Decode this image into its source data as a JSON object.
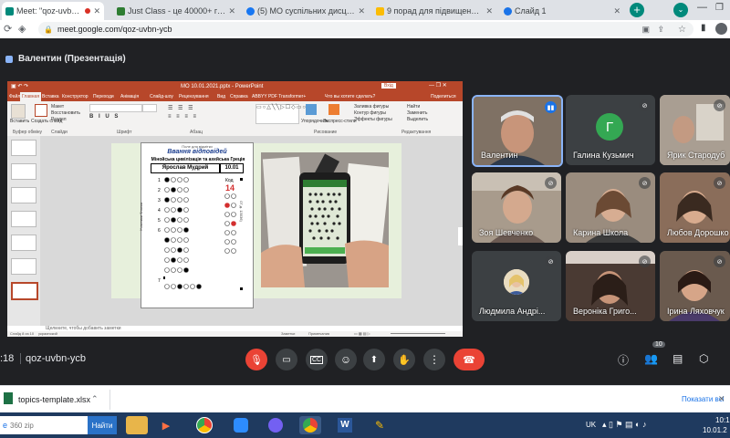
{
  "tabs": [
    {
      "title": "Meet: \"qoz-uvbn-ycb\"",
      "favicon_color": "#00897b",
      "recording": true,
      "active": true
    },
    {
      "title": "Just Class - це 40000+ готові",
      "favicon_color": "#2e7d32",
      "active": false
    },
    {
      "title": "(5) МО суспільних дисциплін",
      "favicon_color": "#1877f2",
      "active": false
    },
    {
      "title": "9 порад для підвищення ефе",
      "favicon_color": "#fbbc04",
      "active": false
    },
    {
      "title": "Слайд 1",
      "favicon_color": "#1a73e8",
      "active": false
    }
  ],
  "address": {
    "url": "meet.google.com/qoz-uvbn-ycb"
  },
  "meet": {
    "presenter_title": "Валентин (Презентація)",
    "meeting_code": "qoz-uvbn-ycb",
    "time": ":18",
    "participant_count": "10"
  },
  "powerpoint": {
    "title": "МО 10.01.2021.pptx  -  PowerPoint",
    "signin": "Вхід",
    "tabs": [
      "Файл",
      "Главная",
      "Вставка",
      "Конструктор",
      "Переходи",
      "Анімація",
      "Слайд-шоу",
      "Рецензування",
      "Вид",
      "Справка",
      "ABBYY PDF Transformer+",
      "Что вы хотите сделать?",
      "Поделиться"
    ],
    "ribbon": {
      "groups": [
        "Буфер обміну",
        "Слайди",
        "Шрифт",
        "Абзац",
        "Рисование",
        "Редактування"
      ],
      "paste": "Вставить",
      "create_slide": "Создать слайд",
      "layout": "Макет",
      "reset": "Восстановить",
      "section": "Раздел",
      "arrange": "Упорядочить",
      "quick_styles": "Экспресс-стили",
      "fill": "Заливка фигуры",
      "outline": "Контур фигуры",
      "effects": "Эффекты фигуры",
      "find": "Найти",
      "replace": "Заменить",
      "select": "Выделить"
    },
    "notes_placeholder": "Щелкните, чтобы добавить заметки",
    "status_slide": "Слайд 8 из 10",
    "status_lang": "украинский",
    "status_notes": "Заметки",
    "status_comments": "Примечания",
    "sheet": {
      "header_small": "Поле для відмітки",
      "header_title": "Ввання відповідей",
      "subject": "Мінойська цивілізація та ахейська Греція",
      "student": "Ярослав Мудрий",
      "date": "10.01",
      "side_text": "Учасники бланка",
      "code_label": "Код",
      "code_value": "14",
      "right_text": "07.д. 13036)",
      "rows": [
        "1",
        "2",
        "3",
        "4",
        "5",
        "6",
        "7"
      ]
    }
  },
  "participants": [
    {
      "name": "Валентин",
      "type": "video",
      "speaking": true,
      "bg": "#7a6d60"
    },
    {
      "name": "Галина Кузьмич",
      "type": "avatar",
      "initial": "Г",
      "avatar_color": "#34a853"
    },
    {
      "name": "Ярик Стародуб",
      "type": "video",
      "bg": "#b3a89c"
    },
    {
      "name": "Зоя Шевченко",
      "type": "video",
      "bg": "#a69a8b"
    },
    {
      "name": "Карина Школа",
      "type": "video",
      "bg": "#8f8275"
    },
    {
      "name": "Любов Дорошко",
      "type": "video",
      "bg": "#8a6d5a"
    },
    {
      "name": "Людмила Андрі...",
      "type": "photo",
      "bg": "#3c4043"
    },
    {
      "name": "Вероніка Григо...",
      "type": "video",
      "bg": "#4a3a33"
    },
    {
      "name": "Ірина Ляховчук",
      "type": "video",
      "bg": "#6a5a4e"
    }
  ],
  "download": {
    "file": "topics-template.xlsx",
    "show_all": "Показати всі"
  },
  "taskbar": {
    "search_placeholder": "360 zip",
    "search_button": "Найти",
    "lang": "UK",
    "time": "10:1",
    "date": "10.01.2"
  },
  "colors": {
    "meet_bg": "#202124",
    "end_call": "#ea4335",
    "ppt_accent": "#b7472a",
    "taskbar": "#1f3a5f"
  }
}
